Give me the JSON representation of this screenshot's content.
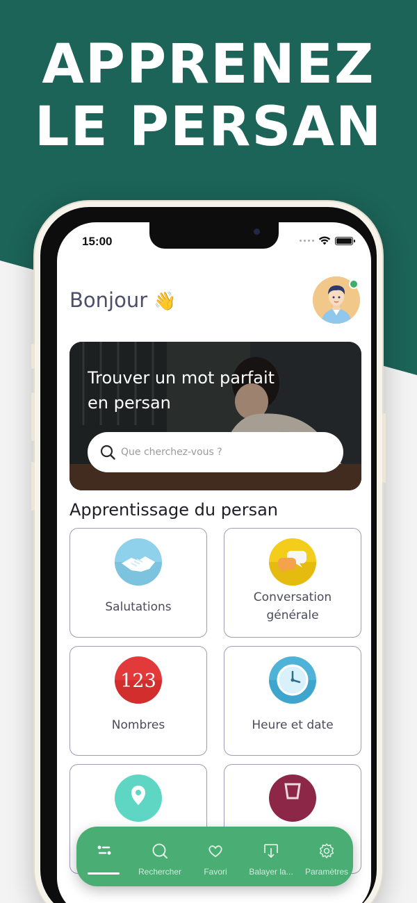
{
  "headline": {
    "line1": "APPRENEZ",
    "line2": "LE PERSAN"
  },
  "status_bar": {
    "time": "15:00"
  },
  "header": {
    "greeting": "Bonjour",
    "wave_emoji": "👋"
  },
  "hero": {
    "title_line1": "Trouver un mot parfait",
    "title_line2": "en persan",
    "search_placeholder": "Que cherchez-vous ?"
  },
  "section": {
    "title": "Apprentissage du persan"
  },
  "categories": [
    {
      "label": "Salutations",
      "icon": "handshake-icon"
    },
    {
      "label_line1": "Conversation",
      "label_line2": "générale",
      "icon": "speech-bubbles-icon"
    },
    {
      "label": "Nombres",
      "icon": "numbers-123-icon",
      "icon_text": "123"
    },
    {
      "label": "Heure et date",
      "icon": "clock-icon"
    },
    {
      "label": "",
      "icon": "location-pin-icon"
    },
    {
      "label": "",
      "icon": "glass-icon"
    }
  ],
  "tabbar": {
    "tabs": [
      {
        "label": "",
        "icon": "home-list-icon",
        "active": true
      },
      {
        "label": "Rechercher",
        "icon": "search-icon"
      },
      {
        "label": "Favori",
        "icon": "heart-icon"
      },
      {
        "label": "Balayer la...",
        "icon": "download-swipe-icon"
      },
      {
        "label": "Paramètres",
        "icon": "gear-icon"
      }
    ]
  },
  "colors": {
    "background_green": "#1c6358",
    "tabbar_green": "#49ad74",
    "status_online": "#3fae6a",
    "text_dark": "#4b4f6c"
  }
}
